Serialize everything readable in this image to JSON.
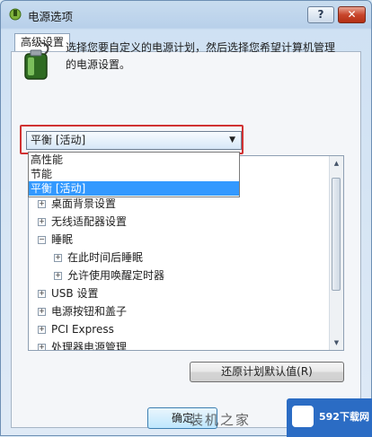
{
  "window": {
    "title": "电源选项",
    "help_label": "?",
    "close_label": "✕"
  },
  "tab": {
    "label": "高级设置"
  },
  "description": "选择您要自定义的电源计划，然后选择您希望计算机管理的电源设置。",
  "plan_combo": {
    "selected": "平衡 [活动]",
    "options": [
      "高性能",
      "节能",
      "平衡 [活动]"
    ],
    "selected_index": 2
  },
  "settings_tree": [
    {
      "label": "桌面背景设置",
      "expander": "+",
      "level": 0
    },
    {
      "label": "无线适配器设置",
      "expander": "+",
      "level": 0
    },
    {
      "label": "睡眠",
      "expander": "−",
      "level": 0
    },
    {
      "label": "在此时间后睡眠",
      "expander": "+",
      "level": 1
    },
    {
      "label": "允许使用唤醒定时器",
      "expander": "+",
      "level": 1
    },
    {
      "label": "USB 设置",
      "expander": "+",
      "level": 0
    },
    {
      "label": "电源按钮和盖子",
      "expander": "+",
      "level": 0
    },
    {
      "label": "PCI Express",
      "expander": "+",
      "level": 0
    },
    {
      "label": "处理器电源管理",
      "expander": "+",
      "level": 0
    }
  ],
  "buttons": {
    "restore": "还原计划默认值(R)",
    "ok": "确定"
  },
  "watermark": "装机之家",
  "badge": {
    "text": "592下载网"
  },
  "colors": {
    "highlight_border": "#d03232",
    "selection": "#3399ff",
    "badge": "#2b6cc4"
  }
}
